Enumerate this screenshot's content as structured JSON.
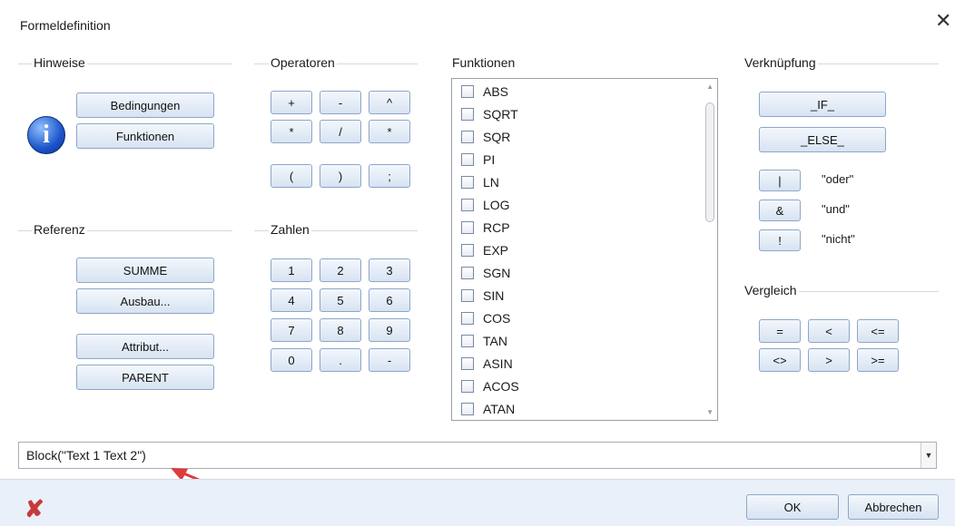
{
  "window": {
    "title": "Formeldefinition",
    "close_glyph": "✕"
  },
  "hints": {
    "label": "Hinweise",
    "buttons": [
      "Bedingungen",
      "Funktionen"
    ],
    "icon": "info-icon"
  },
  "operators": {
    "label": "Operatoren",
    "row1": [
      "+",
      "-",
      "^"
    ],
    "row2": [
      "*",
      "/",
      "*"
    ],
    "row3": [
      "(",
      ")",
      ";"
    ]
  },
  "numbers": {
    "label": "Zahlen",
    "row1": [
      "1",
      "2",
      "3"
    ],
    "row2": [
      "4",
      "5",
      "6"
    ],
    "row3": [
      "7",
      "8",
      "9"
    ],
    "row4": [
      "0",
      ".",
      "-"
    ]
  },
  "reference": {
    "label": "Referenz",
    "buttons": [
      "SUMME",
      "Ausbau...",
      "Attribut...",
      "PARENT"
    ]
  },
  "functions": {
    "label": "Funktionen",
    "items": [
      "ABS",
      "SQRT",
      "SQR",
      "PI",
      "LN",
      "LOG",
      "RCP",
      "EXP",
      "SGN",
      "SIN",
      "COS",
      "TAN",
      "ASIN",
      "ACOS",
      "ATAN"
    ]
  },
  "link": {
    "label": "Verknüpfung",
    "if": "_IF_",
    "else": "_ELSE_",
    "ops": [
      {
        "symbol": "|",
        "text": "\"oder\""
      },
      {
        "symbol": "&",
        "text": "\"und\""
      },
      {
        "symbol": "!",
        "text": "\"nicht\""
      }
    ]
  },
  "compare": {
    "label": "Vergleich",
    "row1": [
      "=",
      "<",
      "<="
    ],
    "row2": [
      "<>",
      ">",
      ">="
    ]
  },
  "formula": {
    "value": "Block(\"Text 1 Text 2\")",
    "dropdown_glyph": "▼"
  },
  "footer": {
    "ok": "OK",
    "cancel": "Abbrechen",
    "delete_glyph": "✘"
  },
  "colors": {
    "annotation_arrow": "#e03a3a",
    "footer_bg": "#e9f0f9"
  }
}
